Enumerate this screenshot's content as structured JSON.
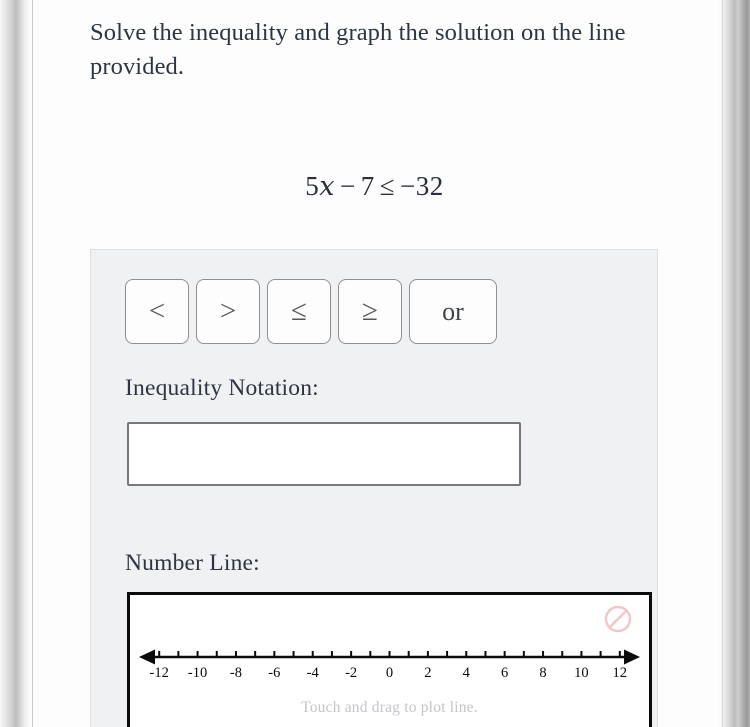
{
  "prompt": {
    "text": "Solve the inequality and graph the solution on the line provided."
  },
  "equation": {
    "coefficient": "5",
    "variable": "x",
    "minus": "−",
    "constant": "7",
    "relation": "≤",
    "rhs": "−32",
    "full": "5x − 7 ≤ −32"
  },
  "keypad": {
    "keys": [
      {
        "label": "<",
        "name": "less-than-button"
      },
      {
        "label": ">",
        "name": "greater-than-button"
      },
      {
        "label": "≤",
        "name": "less-than-or-equal-button"
      },
      {
        "label": "≥",
        "name": "greater-than-or-equal-button"
      },
      {
        "label": "or",
        "name": "or-button"
      }
    ]
  },
  "notation": {
    "label": "Inequality Notation:",
    "value": "",
    "placeholder": ""
  },
  "number_line": {
    "label": "Number Line:",
    "hint": "Touch and drag to plot line.",
    "clear_icon": "prohibition-icon",
    "min": -13,
    "max": 13,
    "tick_min": -13,
    "tick_max": 13,
    "tick_step": 1,
    "labels": [
      -12,
      -10,
      -8,
      -6,
      -4,
      -2,
      0,
      2,
      4,
      6,
      8,
      10,
      12
    ],
    "label_step": 2,
    "plotted": false
  },
  "colors": {
    "text": "#2d3544",
    "panel_bg": "#f0f1f3",
    "key_border": "#8d9196",
    "input_border": "#77797d",
    "axis": "#0b0b0b",
    "hint": "#c3c5c9",
    "clear_icon": "#f2c5c9"
  }
}
